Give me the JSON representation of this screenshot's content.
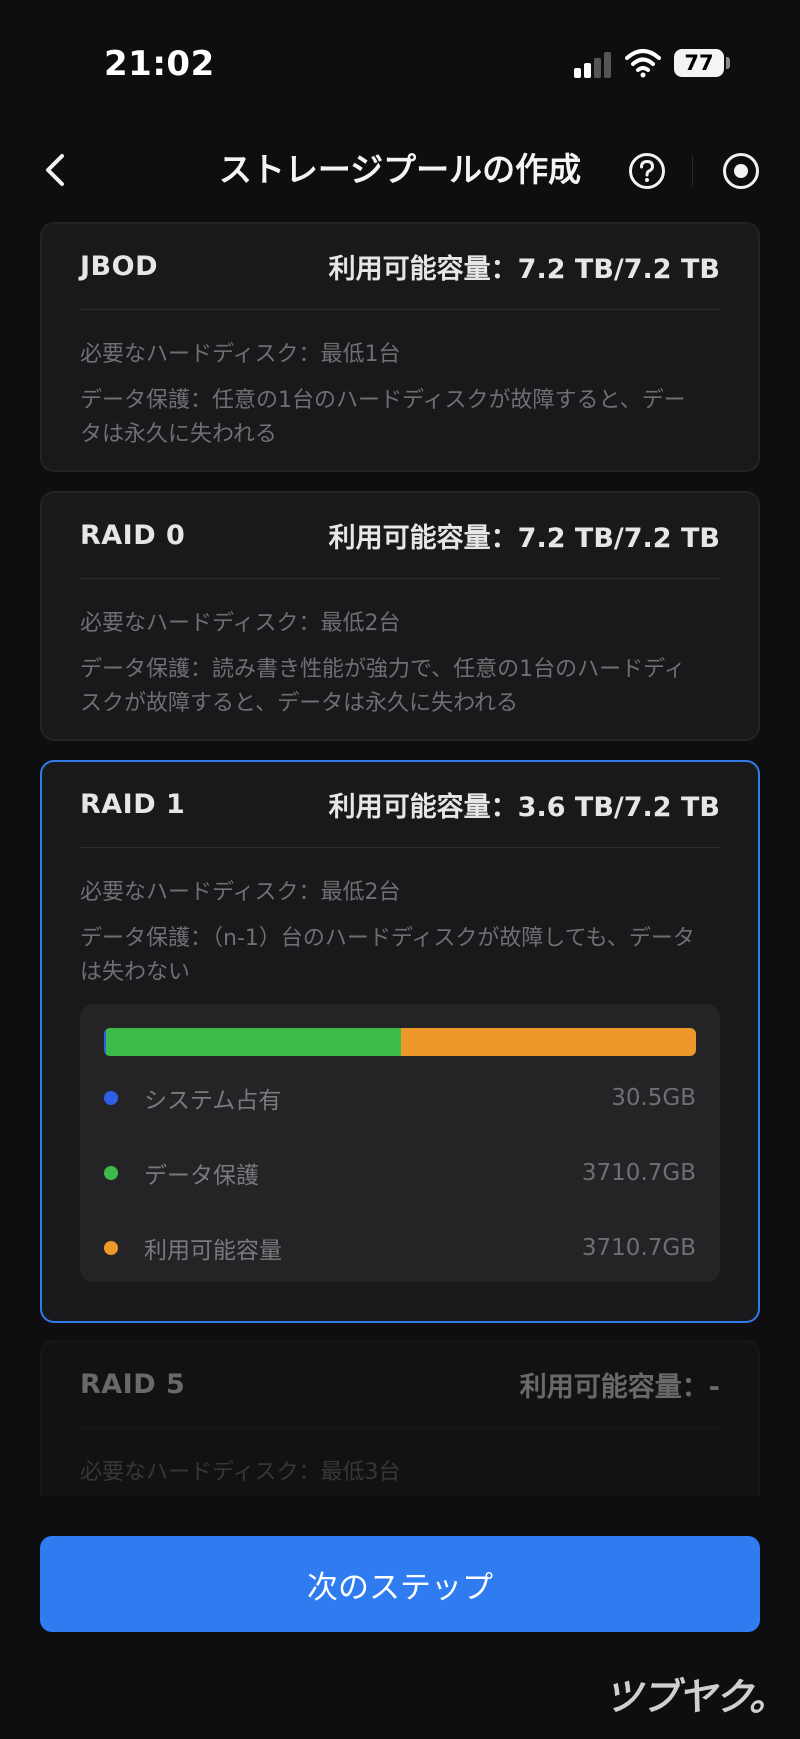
{
  "status_bar": {
    "time": "21:02",
    "battery": "77"
  },
  "header": {
    "title": "ストレージプールの作成"
  },
  "cards": [
    {
      "name": "JBOD",
      "capacity": "利用可能容量：7.2 TB/7.2 TB",
      "requirement": "必要なハードディスク：最低1台",
      "protection": "データ保護：任意の1台のハードディスクが故障すると、データは永久に失われる"
    },
    {
      "name": "RAID 0",
      "capacity": "利用可能容量：7.2 TB/7.2 TB",
      "requirement": "必要なハードディスク：最低2台",
      "protection": "データ保護：読み書き性能が強力で、任意の1台のハードディスクが故障すると、データは永久に失われる"
    },
    {
      "name": "RAID 1",
      "capacity": "利用可能容量：3.6 TB/7.2 TB",
      "requirement": "必要なハードディスク：最低2台",
      "protection": "データ保護：（n-1）台のハードディスクが故障しても、データは失わない",
      "selected": true,
      "breakdown": [
        {
          "label": "システム占有",
          "value": "30.5GB",
          "color": "#2f5ee8",
          "fraction": 0.004
        },
        {
          "label": "データ保護",
          "value": "3710.7GB",
          "color": "#3dbb4a",
          "fraction": 0.498
        },
        {
          "label": "利用可能容量",
          "value": "3710.7GB",
          "color": "#ee972a",
          "fraction": 0.498
        }
      ]
    },
    {
      "name": "RAID 5",
      "capacity": "利用可能容量：-",
      "requirement": "必要なハードディスク：最低3台",
      "protection": "",
      "disabled": true
    }
  ],
  "next_button": {
    "label": "次のステップ"
  },
  "watermark": "ツブヤク。",
  "colors": {
    "accent": "#2f7cf0",
    "background": "#0e0e10",
    "card": "#19191b"
  }
}
